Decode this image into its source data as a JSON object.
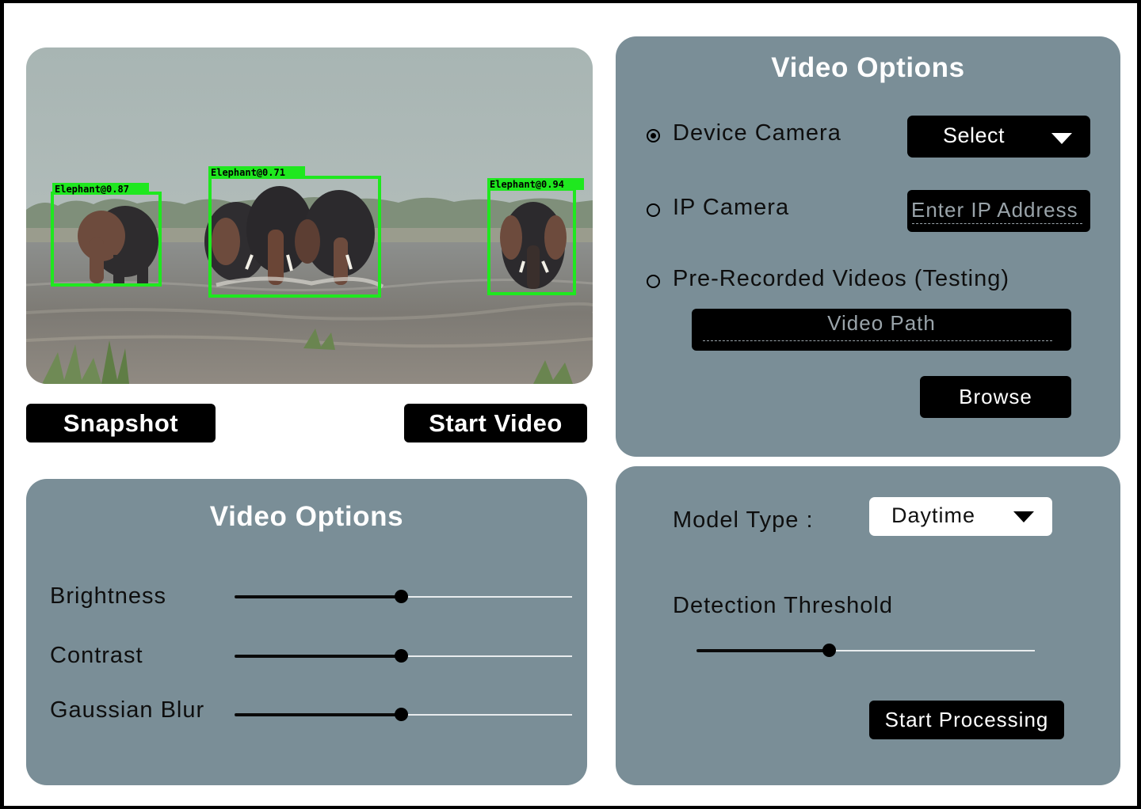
{
  "preview": {
    "detections": [
      {
        "label": "Elephant@0.87"
      },
      {
        "label": "Elephant@0.71"
      },
      {
        "label": "Elephant@0.94"
      }
    ]
  },
  "actions": {
    "snapshot_label": "Snapshot",
    "start_video_label": "Start Video"
  },
  "source_panel": {
    "title": "Video Options",
    "device_camera_label": "Device Camera",
    "device_camera_selected": true,
    "camera_select_value": "Select",
    "ip_camera_label": "IP Camera",
    "ip_placeholder": "Enter IP Address",
    "prerecorded_label": "Pre-Recorded Videos (Testing)",
    "video_path_placeholder": "Video Path",
    "browse_label": "Browse"
  },
  "adjust_panel": {
    "title": "Video Options",
    "sliders": [
      {
        "label": "Brightness",
        "value": 0.5
      },
      {
        "label": "Contrast",
        "value": 0.5
      },
      {
        "label": "Gaussian Blur",
        "value": 0.5
      }
    ]
  },
  "model_panel": {
    "model_type_label": "Model Type :",
    "model_type_value": "Daytime",
    "threshold_label": "Detection Threshold",
    "threshold_value": 0.39,
    "start_processing_label": "Start Processing"
  },
  "colors": {
    "panel": "#7a8e97",
    "detection_box": "#1fe81f",
    "button": "#000000"
  }
}
